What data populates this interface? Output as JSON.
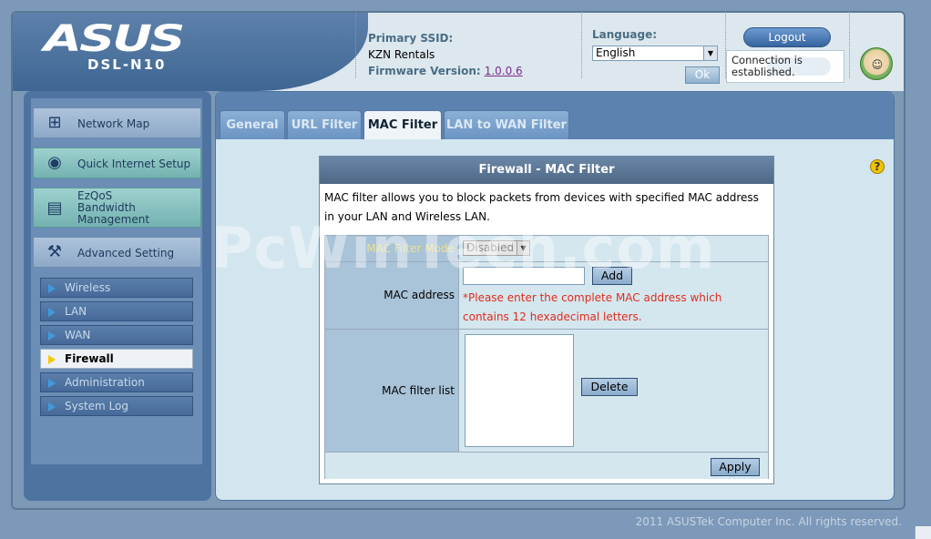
{
  "header": {
    "brand": "ASUS",
    "model": "DSL-N10",
    "ssid_label": "Primary SSID:",
    "ssid_value": "KZN Rentals",
    "firmware_label": "Firmware Version:",
    "firmware_value": "1.0.0.6",
    "language_label": "Language:",
    "language_selected": "English",
    "ok_label": "Ok",
    "logout_label": "Logout",
    "connection_status": "Connection is established."
  },
  "sidebar": {
    "menu": [
      {
        "label": "Network Map",
        "icon": "network-map-icon"
      },
      {
        "label": "Quick Internet Setup",
        "icon": "router-icon"
      },
      {
        "label": "EzQoS Bandwidth Management",
        "icon": "qos-icon"
      },
      {
        "label": "Advanced Setting",
        "icon": "tools-icon"
      }
    ],
    "submenu": [
      {
        "label": "Wireless"
      },
      {
        "label": "LAN"
      },
      {
        "label": "WAN"
      },
      {
        "label": "Firewall"
      },
      {
        "label": "Administration"
      },
      {
        "label": "System Log"
      }
    ]
  },
  "tabs": [
    "General",
    "URL Filter",
    "MAC Filter",
    "LAN to WAN Filter"
  ],
  "active_tab": "MAC Filter",
  "panel": {
    "title": "Firewall - MAC Filter",
    "description": "MAC filter allows you to block packets from devices with specified MAC address in your LAN and Wireless LAN.",
    "mode_label": "MAC Filter Mode",
    "mode_value": "Disabled",
    "mac_label": "MAC address",
    "mac_value": "",
    "add_label": "Add",
    "warning": "*Please enter the complete MAC address which contains 12 hexadecimal letters.",
    "list_label": "MAC filter list",
    "delete_label": "Delete",
    "apply_label": "Apply"
  },
  "watermark": "PcWinTech.com",
  "footer": "2011 ASUSTek Computer Inc. All rights reserved."
}
